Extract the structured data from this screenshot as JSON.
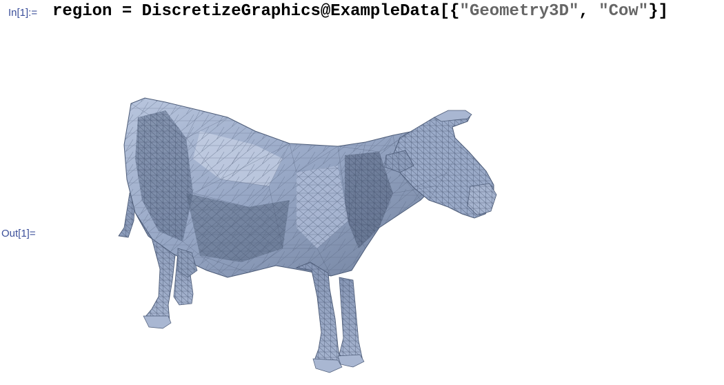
{
  "input_cell": {
    "label": "In[1]:=",
    "var": "region",
    "eq": " = ",
    "fn1": "DiscretizeGraphics",
    "at": "@",
    "fn2": "ExampleData",
    "open": "[{",
    "str1": "\"Geometry3D\"",
    "comma": ", ",
    "str2": "\"Cow\"",
    "close": "}]"
  },
  "output_cell": {
    "label": "Out[1]=",
    "graphic": "cow-3d-mesh",
    "colors": {
      "mesh_fill": "#9aaac8",
      "mesh_light": "#b5c3dd",
      "mesh_dark": "#5f6f8c",
      "mesh_line": "#4c5b77",
      "label": "#3b4f9a"
    }
  }
}
